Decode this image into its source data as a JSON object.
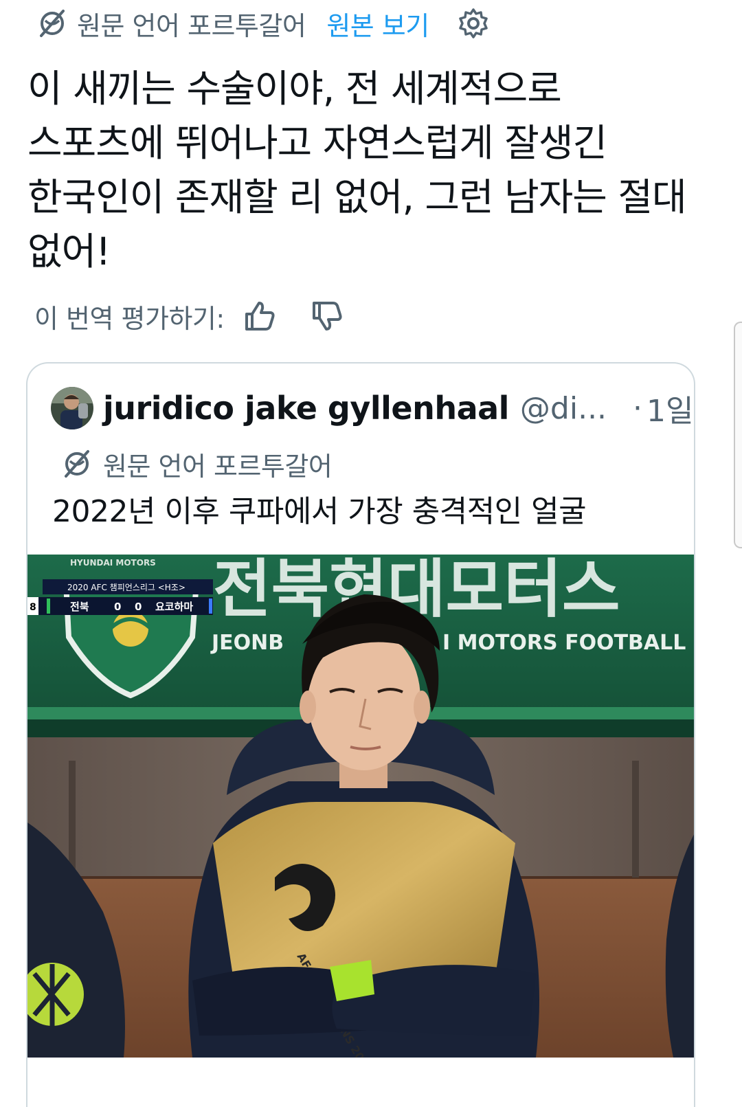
{
  "translation_bar": {
    "icon": "globe-strike-icon",
    "source_language": "원문 언어 포르투갈어",
    "view_original": "원본 보기",
    "settings_icon": "gear-icon"
  },
  "tweet": {
    "text": "이 새끼는 수술이야, 전 세계적으로\n스포츠에 뛰어나고 자연스럽게 잘생긴\n한국인이 존재할 리 없어, 그런 남자는 절대\n없어!"
  },
  "rate": {
    "label": "이 번역 평가하기:",
    "up_icon": "thumbs-up-icon",
    "down_icon": "thumbs-down-icon"
  },
  "quote": {
    "name": "juridico jake gyllenhaal",
    "handle": "@di...",
    "dot": "·",
    "time": "1일",
    "source_language": "원문 언어 포르투갈어",
    "text": "2022년 이후 쿠파에서 가장 충격적인 얼굴",
    "media": {
      "banner_korean": "전북현대모터스",
      "banner_english": "JEONB",
      "banner_english_2": "I MOTORS FOOTBALL",
      "crest_top": "HYUNDAI MOTORS",
      "scoreboard_title": "2020 AFC 챔피언스리그 <H조>",
      "scoreboard_time": "8",
      "home_team": "전북",
      "home_score": "0",
      "away_score": "0",
      "away_team": "요코하마",
      "bib_text": "AFC CHAMPIONS 2020"
    }
  }
}
